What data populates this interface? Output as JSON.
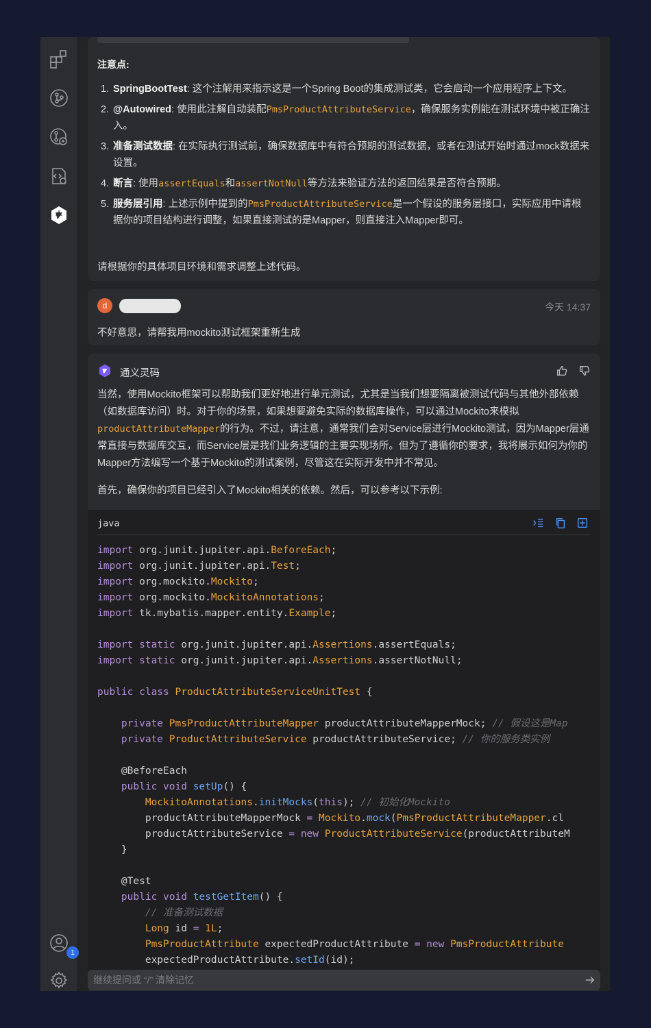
{
  "sidebar": {
    "icons": [
      "extensions-icon",
      "git-branch-icon",
      "git-compare-icon",
      "settings-code-icon",
      "tongyi-logo-icon"
    ],
    "account_badge": "1"
  },
  "notes_card": {
    "title": "注意点:",
    "points": [
      {
        "num": "1.",
        "bold": "SpringBootTest",
        "pre": ": 这个注解用来指示这是一个Spring Boot的集成测试类，它会启动一个应用程序上下文。",
        "code": "",
        "post": ""
      },
      {
        "num": "2.",
        "bold": "@Autowired",
        "pre": ": 使用此注解自动装配",
        "code": "PmsProductAttributeService",
        "post": "，确保服务实例能在测试环境中被正确注入。"
      },
      {
        "num": "3.",
        "bold": "准备测试数据",
        "pre": ": 在实际执行测试前，确保数据库中有符合预期的测试数据，或者在测试开始时通过mock数据来设置。",
        "code": "",
        "post": ""
      },
      {
        "num": "4.",
        "bold": "断言",
        "pre": ": 使用",
        "code": "assertEquals",
        "mid": "和",
        "code2": "assertNotNull",
        "post": "等方法来验证方法的返回结果是否符合预期。"
      },
      {
        "num": "5.",
        "bold": "服务层引用",
        "pre": ": 上述示例中提到的",
        "code": "PmsProductAttributeService",
        "post": "是一个假设的服务层接口，实际应用中请根据你的项目结构进行调整，如果直接测试的是Mapper，则直接注入Mapper即可。"
      }
    ],
    "closing": "请根据你的具体项目环境和需求调整上述代码。"
  },
  "user_message": {
    "avatar_letter": "d",
    "time": "今天 14:37",
    "text": "不好意思，请帮我用mockito测试框架重新生成"
  },
  "ai_message": {
    "name": "通义灵码",
    "para1_a": "当然，使用Mockito框架可以帮助我们更好地进行单元测试，尤其是当我们想要隔离被测试代码与其他外部依赖（如数据库访问）时。对于你的场景，如果想要避免实际的数据库操作，可以通过Mockito来模拟",
    "para1_code": "productAttributeMapper",
    "para1_b": "的行为。不过，请注意，通常我们会对Service层进行Mockito测试，因为Mapper层通常直接与数据库交互，而Service层是我们业务逻辑的主要实现场所。但为了遵循你的要求，我将展示如何为你的Mapper方法编写一个基于Mockito的测试案例，尽管这在实际开发中并不常见。",
    "para2": "首先，确保你的项目已经引入了Mockito相关的依赖。然后，可以参考以下示例:",
    "code_lang": "java",
    "code_lines": [
      [
        [
          "k",
          "import"
        ],
        [
          "p",
          " org.junit.jupiter.api."
        ],
        [
          "t",
          "BeforeEach"
        ],
        [
          "p",
          ";"
        ]
      ],
      [
        [
          "k",
          "import"
        ],
        [
          "p",
          " org.junit.jupiter.api."
        ],
        [
          "t",
          "Test"
        ],
        [
          "p",
          ";"
        ]
      ],
      [
        [
          "k",
          "import"
        ],
        [
          "p",
          " org.mockito."
        ],
        [
          "t",
          "Mockito"
        ],
        [
          "p",
          ";"
        ]
      ],
      [
        [
          "k",
          "import"
        ],
        [
          "p",
          " org.mockito."
        ],
        [
          "t",
          "MockitoAnnotations"
        ],
        [
          "p",
          ";"
        ]
      ],
      [
        [
          "k",
          "import"
        ],
        [
          "p",
          " tk.mybatis.mapper.entity."
        ],
        [
          "t",
          "Example"
        ],
        [
          "p",
          ";"
        ]
      ],
      [],
      [
        [
          "k",
          "import static"
        ],
        [
          "p",
          " org.junit.jupiter.api."
        ],
        [
          "t",
          "Assertions"
        ],
        [
          "p",
          ".assertEquals;"
        ]
      ],
      [
        [
          "k",
          "import static"
        ],
        [
          "p",
          " org.junit.jupiter.api."
        ],
        [
          "t",
          "Assertions"
        ],
        [
          "p",
          ".assertNotNull;"
        ]
      ],
      [],
      [
        [
          "k",
          "public class"
        ],
        [
          "p",
          " "
        ],
        [
          "t",
          "ProductAttributeServiceUnitTest"
        ],
        [
          "p",
          " {"
        ]
      ],
      [],
      [
        [
          "p",
          "    "
        ],
        [
          "k",
          "private"
        ],
        [
          "p",
          " "
        ],
        [
          "t",
          "PmsProductAttributeMapper"
        ],
        [
          "p",
          " productAttributeMapperMock; "
        ],
        [
          "cm",
          "// 假设这是Map"
        ]
      ],
      [
        [
          "p",
          "    "
        ],
        [
          "k",
          "private"
        ],
        [
          "p",
          " "
        ],
        [
          "t",
          "ProductAttributeService"
        ],
        [
          "p",
          " productAttributeService; "
        ],
        [
          "cm",
          "// 你的服务类实例"
        ]
      ],
      [],
      [
        [
          "p",
          "    @BeforeEach"
        ]
      ],
      [
        [
          "p",
          "    "
        ],
        [
          "k",
          "public void"
        ],
        [
          "p",
          " "
        ],
        [
          "f",
          "setUp"
        ],
        [
          "p",
          "() {"
        ]
      ],
      [
        [
          "p",
          "        "
        ],
        [
          "t",
          "MockitoAnnotations"
        ],
        [
          "p",
          "."
        ],
        [
          "f",
          "initMocks"
        ],
        [
          "p",
          "("
        ],
        [
          "k",
          "this"
        ],
        [
          "p",
          "); "
        ],
        [
          "cm",
          "// 初始化Mockito"
        ]
      ],
      [
        [
          "p",
          "        productAttributeMapperMock "
        ],
        [
          "k",
          "="
        ],
        [
          "p",
          " "
        ],
        [
          "t",
          "Mockito"
        ],
        [
          "p",
          "."
        ],
        [
          "f",
          "mock"
        ],
        [
          "p",
          "("
        ],
        [
          "t",
          "PmsProductAttributeMapper"
        ],
        [
          "p",
          ".cl"
        ]
      ],
      [
        [
          "p",
          "        productAttributeService "
        ],
        [
          "k",
          "="
        ],
        [
          "p",
          " "
        ],
        [
          "k",
          "new"
        ],
        [
          "p",
          " "
        ],
        [
          "t",
          "ProductAttributeService"
        ],
        [
          "p",
          "(productAttributeM"
        ]
      ],
      [
        [
          "p",
          "    }"
        ]
      ],
      [],
      [
        [
          "p",
          "    @Test"
        ]
      ],
      [
        [
          "p",
          "    "
        ],
        [
          "k",
          "public void"
        ],
        [
          "p",
          " "
        ],
        [
          "f",
          "testGetItem"
        ],
        [
          "p",
          "() {"
        ]
      ],
      [
        [
          "p",
          "        "
        ],
        [
          "cm",
          "// 准备测试数据"
        ]
      ],
      [
        [
          "p",
          "        "
        ],
        [
          "t",
          "Long"
        ],
        [
          "p",
          " id "
        ],
        [
          "k",
          "="
        ],
        [
          "p",
          " "
        ],
        [
          "t",
          "1L"
        ],
        [
          "p",
          ";"
        ]
      ],
      [
        [
          "p",
          "        "
        ],
        [
          "t",
          "PmsProductAttribute"
        ],
        [
          "p",
          " expectedProductAttribute "
        ],
        [
          "k",
          "="
        ],
        [
          "p",
          " "
        ],
        [
          "k",
          "new"
        ],
        [
          "p",
          " "
        ],
        [
          "t",
          "PmsProductAttribute"
        ]
      ],
      [
        [
          "p",
          "        expectedProductAttribute."
        ],
        [
          "f",
          "setId"
        ],
        [
          "p",
          "(id);"
        ]
      ]
    ]
  },
  "input": {
    "placeholder": "继续提问或 “/” 清除记忆"
  }
}
